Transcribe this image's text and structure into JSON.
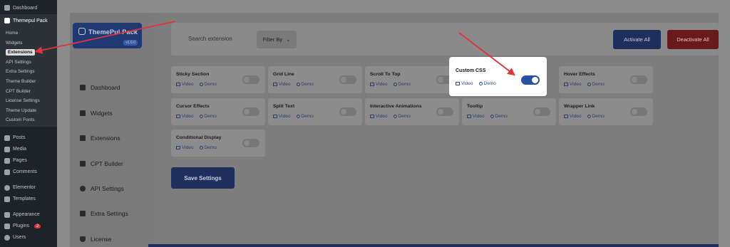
{
  "wp_menu": {
    "top": [
      {
        "label": "Dashboard",
        "icon": "dashboard-icon"
      }
    ],
    "current": {
      "label": "Themepul Pack",
      "icon": "gear-icon"
    },
    "submenu": [
      "Home",
      "Widgets",
      "Extensions",
      "API Settings",
      "Extra Settings",
      "Theme Builder",
      "CPT Builder",
      "License Settings",
      "Theme Update",
      "Custom Fonts"
    ],
    "bottom": [
      {
        "label": "Posts",
        "icon": "pin-icon"
      },
      {
        "label": "Media",
        "icon": "media-icon"
      },
      {
        "label": "Pages",
        "icon": "pages-icon"
      },
      {
        "label": "Comments",
        "icon": "comments-icon"
      },
      {
        "label": "Elementor",
        "icon": "elementor-icon"
      },
      {
        "label": "Templates",
        "icon": "templates-icon"
      },
      {
        "label": "Appearance",
        "icon": "appearance-icon"
      },
      {
        "label": "Plugins",
        "icon": "plugins-icon",
        "badge": "2"
      },
      {
        "label": "Users",
        "icon": "users-icon"
      }
    ]
  },
  "plugin": {
    "logo_text": "ThemePul Pack",
    "version": "v1.0.0",
    "nav": [
      {
        "label": "Dashboard",
        "icon": "dashboard-icon"
      },
      {
        "label": "Widgets",
        "icon": "widgets-icon"
      },
      {
        "label": "Extensions",
        "icon": "extensions-icon"
      },
      {
        "label": "CPT Builder",
        "icon": "cpt-icon"
      },
      {
        "label": "API Settings",
        "icon": "link-icon"
      },
      {
        "label": "Extra Settings",
        "icon": "settings-icon"
      },
      {
        "label": "License",
        "icon": "shield-icon"
      }
    ]
  },
  "toolbar": {
    "search_placeholder": "Search extension",
    "filter_label": "Filter By",
    "activate_all": "Activate All",
    "deactivate_all": "Deactivate All"
  },
  "extensions": [
    {
      "title": "Sticky Section",
      "video": "Video",
      "demo": "Demo",
      "enabled": false
    },
    {
      "title": "Grid Line",
      "video": "Video",
      "demo": "Demo",
      "enabled": false
    },
    {
      "title": "Scroll To Top",
      "video": "Video",
      "demo": "Demo",
      "enabled": false
    },
    {
      "title": "Custom CSS",
      "video": "Video",
      "demo": "Demo",
      "enabled": true
    },
    {
      "title": "Hover Effects",
      "video": "Video",
      "demo": "Demo",
      "enabled": false
    },
    {
      "title": "Cursor Effects",
      "video": "Video",
      "demo": "Demo",
      "enabled": false
    },
    {
      "title": "Split Text",
      "video": "Video",
      "demo": "Demo",
      "enabled": false
    },
    {
      "title": "Interactive Animations",
      "video": "Video",
      "demo": "Demo",
      "enabled": false
    },
    {
      "title": "Tooltip",
      "video": "Video",
      "demo": "Demo",
      "enabled": false
    },
    {
      "title": "Wrapper Link",
      "video": "Video",
      "demo": "Demo",
      "enabled": false
    },
    {
      "title": "Conditional Display",
      "video": "Video",
      "demo": "Demo",
      "enabled": false
    }
  ],
  "save_label": "Save Settings",
  "colors": {
    "accent": "#2b4fa3",
    "danger": "#b01e1e",
    "annotation": "#e0333b"
  }
}
